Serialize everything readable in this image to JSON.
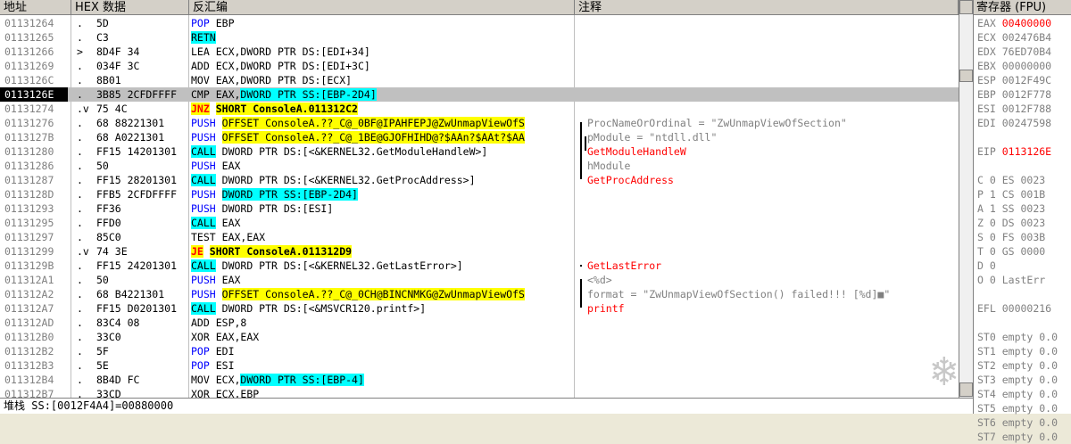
{
  "headers": {
    "address": "地址",
    "hex": "HEX 数据",
    "disasm": "反汇编",
    "comment": "注释",
    "registers": "寄存器 (FPU)"
  },
  "rows": [
    {
      "addr": "01131264",
      "jmp": ".",
      "hex": "5D",
      "mn": "POP",
      "mnStyle": "blue",
      "op": "EBP",
      "opStyle": "",
      "cmt": "",
      "cmtStyle": ""
    },
    {
      "addr": "01131265",
      "jmp": ".",
      "hex": "C3",
      "mn": "RETN",
      "mnStyle": "retn",
      "op": "",
      "opStyle": "",
      "cmt": "",
      "cmtStyle": ""
    },
    {
      "addr": "01131266",
      "jmp": ">",
      "hex": "8D4F 34",
      "mn": "LEA",
      "mnStyle": "",
      "op": "ECX,DWORD PTR DS:[EDI+34]",
      "opStyle": "",
      "cmt": "",
      "cmtStyle": ""
    },
    {
      "addr": "01131269",
      "jmp": ".",
      "hex": "034F 3C",
      "mn": "ADD",
      "mnStyle": "",
      "op": "ECX,DWORD PTR DS:[EDI+3C]",
      "opStyle": "",
      "cmt": "",
      "cmtStyle": ""
    },
    {
      "addr": "0113126C",
      "jmp": ".",
      "hex": "8B01",
      "mn": "MOV",
      "mnStyle": "",
      "op": "EAX,DWORD PTR DS:[ECX]",
      "opStyle": "",
      "cmt": "",
      "cmtStyle": ""
    },
    {
      "addr": "0113126E",
      "jmp": ".",
      "hex": "3B85 2CFDFFFF",
      "mn": "CMP",
      "mnStyle": "",
      "op": "EAX,",
      "op2": "DWORD PTR SS:[EBP-2D4]",
      "opStyle": "cy",
      "cmt": "",
      "cmtStyle": "",
      "sel": true
    },
    {
      "addr": "01131274",
      "jmp": ".v",
      "hex": "75 4C",
      "mn": "JNZ",
      "mnStyle": "red",
      "op": "SHORT ConsoleA.011312C2",
      "opStyle": "yelbold",
      "cmt": "",
      "cmtStyle": ""
    },
    {
      "addr": "01131276",
      "jmp": ".",
      "hex": "68 88221301",
      "mn": "PUSH",
      "mnStyle": "blue",
      "op": "OFFSET ConsoleA.??_C@_0BF@IPAHFEPJ@ZwUnmapViewOfS",
      "opStyle": "yel",
      "cmt": "ProcNameOrOrdinal = \"ZwUnmapViewOfSection\"",
      "cmtStyle": "gray"
    },
    {
      "addr": "0113127B",
      "jmp": ".",
      "hex": "68 A0221301",
      "mn": "PUSH",
      "mnStyle": "blue",
      "op": "OFFSET ConsoleA.??_C@_1BE@GJOFHIHD@?$AAn?$AAt?$AA",
      "opStyle": "yel",
      "cmt": "pModule = \"ntdll.dll\"",
      "cmtStyle": "gray"
    },
    {
      "addr": "01131280",
      "jmp": ".",
      "hex": "FF15 14201301",
      "mn": "CALL",
      "mnStyle": "call",
      "op": "DWORD PTR DS:[<&KERNEL32.GetModuleHandleW>]",
      "opStyle": "",
      "cmt": "GetModuleHandleW",
      "cmtStyle": "red"
    },
    {
      "addr": "01131286",
      "jmp": ".",
      "hex": "50",
      "mn": "PUSH",
      "mnStyle": "blue",
      "op": "EAX",
      "opStyle": "",
      "cmt": "hModule",
      "cmtStyle": "gray"
    },
    {
      "addr": "01131287",
      "jmp": ".",
      "hex": "FF15 28201301",
      "mn": "CALL",
      "mnStyle": "call",
      "op": "DWORD PTR DS:[<&KERNEL32.GetProcAddress>]",
      "opStyle": "",
      "cmt": "GetProcAddress",
      "cmtStyle": "red"
    },
    {
      "addr": "0113128D",
      "jmp": ".",
      "hex": "FFB5 2CFDFFFF",
      "mn": "PUSH",
      "mnStyle": "blue",
      "op": "DWORD PTR SS:[EBP-2D4]",
      "opStyle": "cy",
      "cmt": "",
      "cmtStyle": ""
    },
    {
      "addr": "01131293",
      "jmp": ".",
      "hex": "FF36",
      "mn": "PUSH",
      "mnStyle": "blue",
      "op": "DWORD PTR DS:[ESI]",
      "opStyle": "",
      "cmt": "",
      "cmtStyle": ""
    },
    {
      "addr": "01131295",
      "jmp": ".",
      "hex": "FFD0",
      "mn": "CALL",
      "mnStyle": "call",
      "op": "EAX",
      "opStyle": "",
      "cmt": "",
      "cmtStyle": ""
    },
    {
      "addr": "01131297",
      "jmp": ".",
      "hex": "85C0",
      "mn": "TEST",
      "mnStyle": "",
      "op": "EAX,EAX",
      "opStyle": "",
      "cmt": "",
      "cmtStyle": ""
    },
    {
      "addr": "01131299",
      "jmp": ".v",
      "hex": "74 3E",
      "mn": "JE",
      "mnStyle": "red",
      "op": "SHORT ConsoleA.011312D9",
      "opStyle": "yelbold",
      "cmt": "",
      "cmtStyle": ""
    },
    {
      "addr": "0113129B",
      "jmp": ".",
      "hex": "FF15 24201301",
      "mn": "CALL",
      "mnStyle": "call",
      "op": "DWORD PTR DS:[<&KERNEL32.GetLastError>]",
      "opStyle": "",
      "cmt": "GetLastError",
      "cmtStyle": "red"
    },
    {
      "addr": "011312A1",
      "jmp": ".",
      "hex": "50",
      "mn": "PUSH",
      "mnStyle": "blue",
      "op": "EAX",
      "opStyle": "",
      "cmt": "<%d>",
      "cmtStyle": "gray"
    },
    {
      "addr": "011312A2",
      "jmp": ".",
      "hex": "68 B4221301",
      "mn": "PUSH",
      "mnStyle": "blue",
      "op": "OFFSET ConsoleA.??_C@_0CH@BINCNMKG@ZwUnmapViewOfS",
      "opStyle": "yel",
      "cmt": "format = \"ZwUnmapViewOfSection() failed!!! [%d]■\"",
      "cmtStyle": "gray"
    },
    {
      "addr": "011312A7",
      "jmp": ".",
      "hex": "FF15 D0201301",
      "mn": "CALL",
      "mnStyle": "call",
      "op": "DWORD PTR DS:[<&MSVCR120.printf>]",
      "opStyle": "",
      "cmt": "printf",
      "cmtStyle": "red"
    },
    {
      "addr": "011312AD",
      "jmp": ".",
      "hex": "83C4 08",
      "mn": "ADD",
      "mnStyle": "",
      "op": "ESP,8",
      "opStyle": "",
      "cmt": "",
      "cmtStyle": ""
    },
    {
      "addr": "011312B0",
      "jmp": ".",
      "hex": "33C0",
      "mn": "XOR",
      "mnStyle": "",
      "op": "EAX,EAX",
      "opStyle": "",
      "cmt": "",
      "cmtStyle": ""
    },
    {
      "addr": "011312B2",
      "jmp": ".",
      "hex": "5F",
      "mn": "POP",
      "mnStyle": "blue",
      "op": "EDI",
      "opStyle": "",
      "cmt": "",
      "cmtStyle": ""
    },
    {
      "addr": "011312B3",
      "jmp": ".",
      "hex": "5E",
      "mn": "POP",
      "mnStyle": "blue",
      "op": "ESI",
      "opStyle": "",
      "cmt": "",
      "cmtStyle": ""
    },
    {
      "addr": "011312B4",
      "jmp": ".",
      "hex": "8B4D FC",
      "mn": "MOV",
      "mnStyle": "",
      "op": "ECX,",
      "op2": "DWORD PTR SS:[EBP-4]",
      "opStyle": "cy",
      "cmt": "",
      "cmtStyle": ""
    },
    {
      "addr": "011312B7",
      "jmp": ".",
      "hex": "33CD",
      "mn": "XOR",
      "mnStyle": "",
      "op": "ECX,EBP",
      "opStyle": "",
      "cmt": "",
      "cmtStyle": ""
    }
  ],
  "registers": [
    {
      "name": "EAX",
      "value": "00400000",
      "red": true
    },
    {
      "name": "ECX",
      "value": "002476B4",
      "red": false
    },
    {
      "name": "EDX",
      "value": "76ED70B4",
      "red": false
    },
    {
      "name": "EBX",
      "value": "00000000",
      "red": false
    },
    {
      "name": "ESP",
      "value": "0012F49C",
      "red": false
    },
    {
      "name": "EBP",
      "value": "0012F778",
      "red": false
    },
    {
      "name": "ESI",
      "value": "0012F788",
      "red": false
    },
    {
      "name": "EDI",
      "value": "00247598",
      "red": false
    },
    {
      "name": "",
      "value": "",
      "red": false
    },
    {
      "name": "EIP",
      "value": "0113126E",
      "red": true
    },
    {
      "name": "",
      "value": "",
      "red": false
    },
    {
      "name": "C 0",
      "value": "ES 0023",
      "red": false
    },
    {
      "name": "P 1",
      "value": "CS 001B",
      "red": false
    },
    {
      "name": "A 1",
      "value": "SS 0023",
      "red": false
    },
    {
      "name": "Z 0",
      "value": "DS 0023",
      "red": false
    },
    {
      "name": "S 0",
      "value": "FS 003B",
      "red": false
    },
    {
      "name": "T 0",
      "value": "GS 0000",
      "red": false
    },
    {
      "name": "D 0",
      "value": "",
      "red": false
    },
    {
      "name": "O 0",
      "value": "LastErr",
      "red": false
    },
    {
      "name": "",
      "value": "",
      "red": false
    },
    {
      "name": "EFL",
      "value": "00000216",
      "red": false
    },
    {
      "name": "",
      "value": "",
      "red": false
    },
    {
      "name": "ST0",
      "value": "empty 0.0",
      "red": false
    },
    {
      "name": "ST1",
      "value": "empty 0.0",
      "red": false
    },
    {
      "name": "ST2",
      "value": "empty 0.0",
      "red": false
    },
    {
      "name": "ST3",
      "value": "empty 0.0",
      "red": false
    },
    {
      "name": "ST4",
      "value": "empty 0.0",
      "red": false
    },
    {
      "name": "ST5",
      "value": "empty 0.0",
      "red": false
    },
    {
      "name": "ST6",
      "value": "empty 0.0",
      "red": false
    },
    {
      "name": "ST7",
      "value": "empty 0.0",
      "red": false
    }
  ],
  "status": {
    "label": "堆栈",
    "text": "SS:[0012F4A4]=00880000"
  },
  "colors": {
    "accent_red": "#ff0000",
    "highlight_yellow": "#ffff00",
    "highlight_cyan": "#00ffff",
    "mnemonic_blue": "#0000ff"
  }
}
